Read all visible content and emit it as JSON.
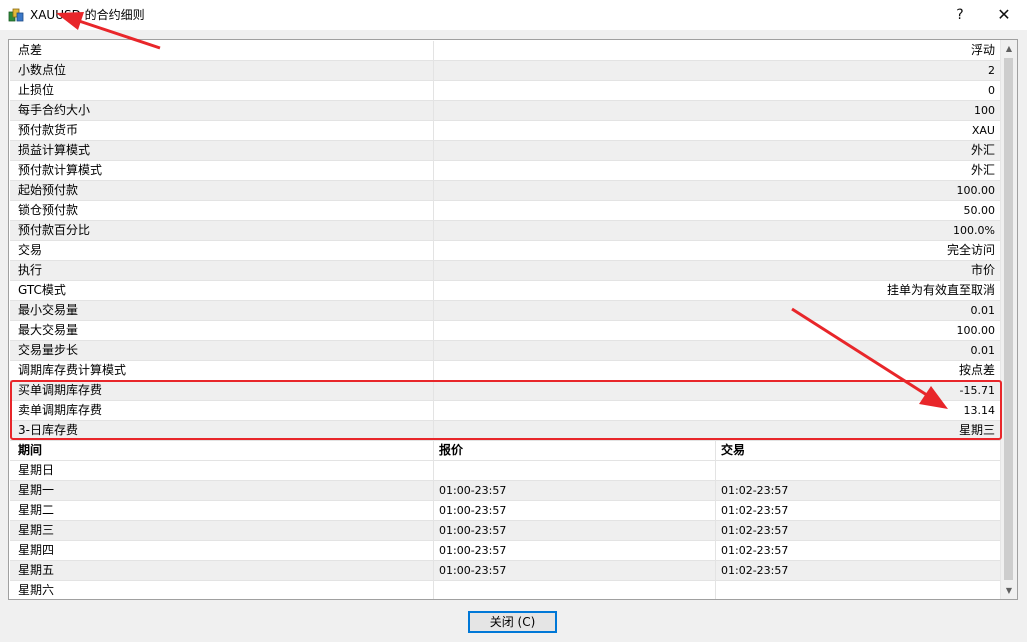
{
  "window": {
    "title": "XAUUSD 的合约细则",
    "help_label": "?",
    "close_label": "✕"
  },
  "specs": [
    {
      "label": "点差",
      "value": "浮动",
      "cn": true
    },
    {
      "label": "小数点位",
      "value": "2"
    },
    {
      "label": "止损位",
      "value": "0"
    },
    {
      "label": "每手合约大小",
      "value": "100"
    },
    {
      "label": "预付款货币",
      "value": "XAU"
    },
    {
      "label": "损益计算模式",
      "value": "外汇",
      "cn": true
    },
    {
      "label": "预付款计算模式",
      "value": "外汇",
      "cn": true
    },
    {
      "label": "起始预付款",
      "value": "100.00"
    },
    {
      "label": "锁仓预付款",
      "value": "50.00"
    },
    {
      "label": "预付款百分比",
      "value": "100.0%"
    },
    {
      "label": "交易",
      "value": "完全访问",
      "cn": true
    },
    {
      "label": "执行",
      "value": "市价",
      "cn": true
    },
    {
      "label": "GTC模式",
      "value": "挂单为有效直至取消",
      "cn": true
    },
    {
      "label": "最小交易量",
      "value": "0.01"
    },
    {
      "label": "最大交易量",
      "value": "100.00"
    },
    {
      "label": "交易量步长",
      "value": "0.01"
    },
    {
      "label": "调期库存费计算模式",
      "value": "按点差",
      "cn": true
    },
    {
      "label": "买单调期库存费",
      "value": "-15.71"
    },
    {
      "label": "卖单调期库存费",
      "value": "13.14"
    },
    {
      "label": "3-日库存费",
      "value": "星期三",
      "cn": true
    }
  ],
  "schedule": {
    "headers": {
      "day": "期间",
      "quote": "报价",
      "trade": "交易"
    },
    "rows": [
      {
        "day": "星期日",
        "quote": "",
        "trade": ""
      },
      {
        "day": "星期一",
        "quote": "01:00-23:57",
        "trade": "01:02-23:57"
      },
      {
        "day": "星期二",
        "quote": "01:00-23:57",
        "trade": "01:02-23:57"
      },
      {
        "day": "星期三",
        "quote": "01:00-23:57",
        "trade": "01:02-23:57"
      },
      {
        "day": "星期四",
        "quote": "01:00-23:57",
        "trade": "01:02-23:57"
      },
      {
        "day": "星期五",
        "quote": "01:00-23:57",
        "trade": "01:02-23:57"
      },
      {
        "day": "星期六",
        "quote": "",
        "trade": ""
      }
    ]
  },
  "footer": {
    "close_button": "关闭 (C)"
  },
  "colors": {
    "annotation_red": "#e8262a",
    "focus_blue": "#0078d7"
  }
}
